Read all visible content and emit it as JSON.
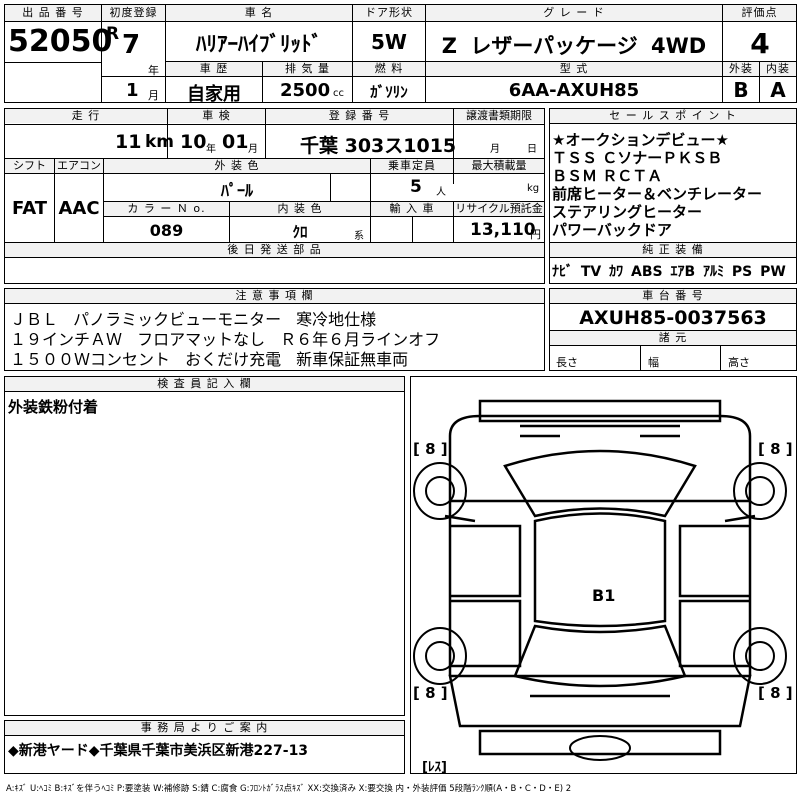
{
  "headers": {
    "lot_no": "出 品 番 号",
    "first_reg": "初度登録",
    "car_name": "車 名",
    "door": "ドア形状",
    "grade": "グ レ ー ド",
    "score": "評価点",
    "history": "車 歴",
    "displacement": "排 気 量",
    "fuel": "燃 料",
    "model": "型 式",
    "exterior": "外装",
    "interior": "内装",
    "mileage": "走 行",
    "inspection": "車 検",
    "reg_no": "登 録 番 号",
    "transfer_deadline": "譲渡書類期限",
    "shift": "シフト",
    "aircon": "エアコン",
    "ext_color": "外 装 色",
    "capacity": "乗車定員",
    "max_load": "最大積載量",
    "color_no": "カ ラ ー Ｎ ο.",
    "int_color": "内 装 色",
    "import": "輸 入 車",
    "recycle": "リサイクル預託金",
    "later_parts": "後 日 発 送 部 品",
    "sales_points": "セ ー ル ス ポ イ ン ト",
    "genuine_equipment": "純 正 装 備",
    "notes": "注 意 事 項 欄",
    "chassis_no": "車 台 番 号",
    "dimensions": "諸 元",
    "inspector": "検 査 員 記 入 欄",
    "office_notice": "事 務 局 よ り ご 案 内"
  },
  "lot_no": "52050",
  "first_reg": {
    "era": "R",
    "year": "7",
    "year_unit": "年",
    "month": "1",
    "month_unit": "月"
  },
  "car_name": "ﾊﾘｱｰﾊｲﾌﾞﾘｯﾄﾞ",
  "door": "5W",
  "grade": "Z レザーパッケージ 4WD",
  "score": "4",
  "history": "自家用",
  "displacement": "2500",
  "displacement_unit": "cc",
  "fuel": "ｶﾞｿﾘﾝ",
  "model": "6AA-AXUH85",
  "exterior_grade": "B",
  "interior_grade": "A",
  "mileage": "11",
  "mileage_unit": "km",
  "inspection": {
    "year": "10",
    "year_unit": "年",
    "month": "01",
    "month_unit": "月"
  },
  "reg_no": "千葉 303ス1015",
  "transfer_deadline": {
    "month_unit": "月",
    "day_unit": "日"
  },
  "shift": "FAT",
  "aircon": "AAC",
  "ext_color": "ﾊﾟｰﾙ",
  "capacity": "5",
  "capacity_unit": "人",
  "max_load_unit": "kg",
  "color_no": "089",
  "int_color": "ｸﾛ",
  "int_color_unit": "系",
  "recycle": "13,110",
  "recycle_unit": "円",
  "sales_points": [
    "★オークションデビュー★",
    "ＴＳＳ ＣソナーＰＫＳＢ",
    "ＢＳＭ ＲＣＴＡ",
    "前席ヒーター＆ベンチレーター",
    "ステアリングヒーター",
    "パワーバックドア"
  ],
  "genuine_equipment": "ﾅﾋﾞ TV ｶﾜ ABS ｴｱB ｱﾙﾐ PS PW",
  "notes": [
    "ＪＢＬ パノラミックビューモニター 寒冷地仕様",
    "１９インチＡＷ フロアマットなし Ｒ６年６月ラインオフ",
    "１５００Ｗコンセント おくだけ充電 新車保証無車両"
  ],
  "chassis_no": "AXUH85-0037563",
  "dimensions": {
    "length": "長さ",
    "width": "幅",
    "height": "高さ"
  },
  "inspector_text": "外装鉄粉付着",
  "diagram": {
    "tire_fl": "[ 8 ]",
    "tire_fr": "[ 8 ]",
    "tire_rl": "[ 8 ]",
    "tire_rr": "[ 8 ]",
    "spare": "[ﾚｽ]",
    "mark_b1": "B1"
  },
  "office_notice": "◆新港ヤード◆千葉県千葉市美浜区新港227-13",
  "legend": "A:ｷｽﾞ U:ﾍｺﾐ B:ｷｽﾞを伴うﾍｺﾐ P:要塗装 W:補修跡 S:錆 C:腐食 G:ﾌﾛﾝﾄｶﾞﾗｽ点ｷｽﾞ XX:交換済み X:要交換 内・外装評価 5段階ﾗﾝｸ順(A・B・C・D・E) 2"
}
